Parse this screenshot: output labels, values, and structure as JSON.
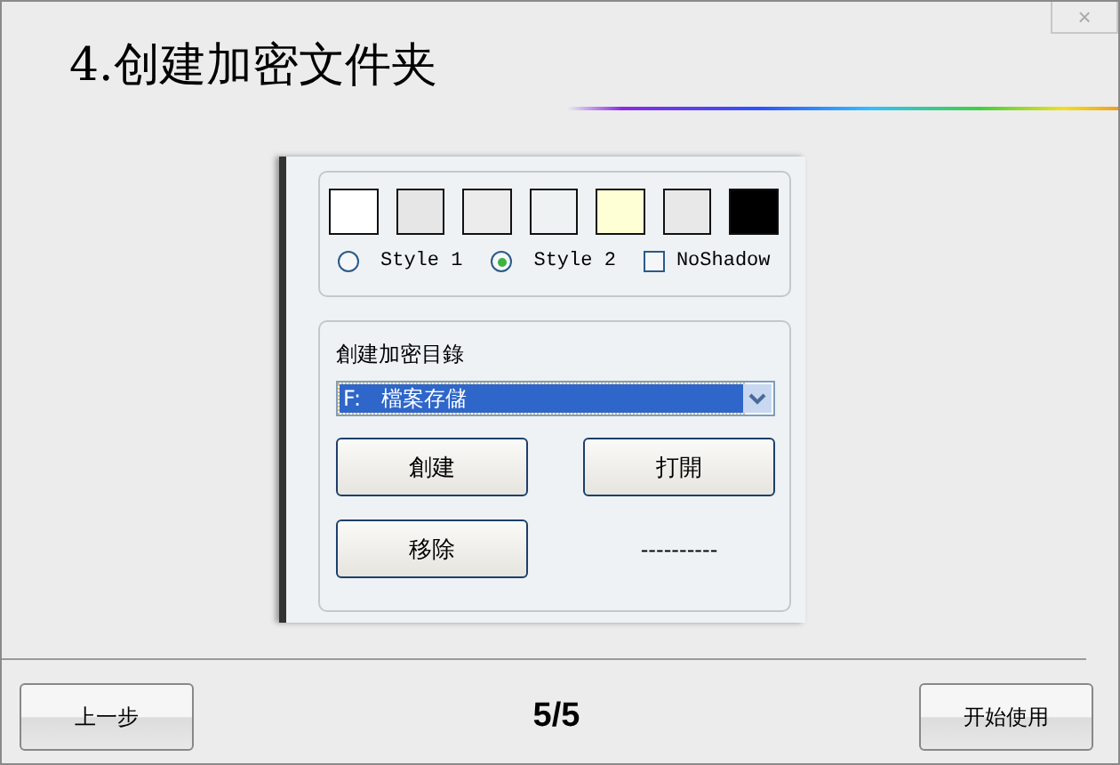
{
  "window": {
    "close_label": "×"
  },
  "title": "4.创建加密文件夹",
  "style_panel": {
    "swatches": [
      {
        "color": "#ffffff"
      },
      {
        "color": "#e6e6e6"
      },
      {
        "color": "#ececec"
      },
      {
        "color": "#eef2f2"
      },
      {
        "color": "#ffffd6"
      },
      {
        "color": "#e8e8e8"
      },
      {
        "color": "#000000"
      }
    ],
    "styles": [
      {
        "label": "Style 1",
        "selected": false
      },
      {
        "label": "Style 2",
        "selected": true
      }
    ],
    "no_shadow": {
      "label": "NoShadow",
      "checked": false
    }
  },
  "dir_panel": {
    "label": "創建加密目錄",
    "drive": {
      "value": "F:   檔案存儲"
    },
    "buttons": [
      "創建",
      "打開",
      "移除"
    ],
    "status": "----------"
  },
  "nav": {
    "back": "上一步",
    "page": "5/5",
    "start": "开始使用"
  }
}
